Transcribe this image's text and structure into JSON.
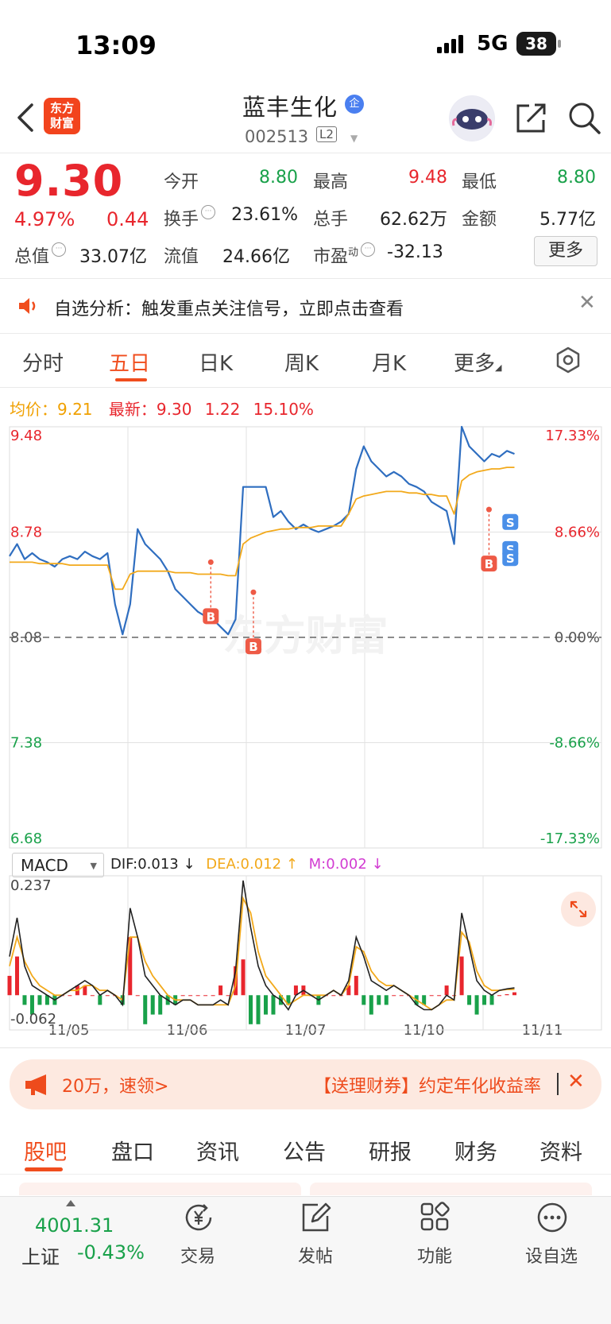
{
  "status_bar": {
    "time": "13:09",
    "network": "5G",
    "battery": "38"
  },
  "header": {
    "logo_text": [
      "东方",
      "财富"
    ],
    "stock_name": "蓝丰生化",
    "verified_badge": "企",
    "stock_code": "002513",
    "level_badge": "L2"
  },
  "quote": {
    "price": "9.30",
    "change_pct": "4.97%",
    "change_amt": "0.44",
    "rows": [
      [
        {
          "label": "今开",
          "value": "8.80",
          "color": "green"
        },
        {
          "label": "最高",
          "value": "9.48",
          "color": "red"
        },
        {
          "label": "最低",
          "value": "8.80",
          "color": "green"
        }
      ],
      [
        {
          "label": "换手",
          "value": "23.61%",
          "color": "black"
        },
        {
          "label": "总手",
          "value": "62.62万",
          "color": "black"
        },
        {
          "label": "金额",
          "value": "5.77亿",
          "color": "black"
        }
      ]
    ],
    "total_value_label": "总值",
    "total_value": "33.07亿",
    "float_label": "流值",
    "float_value": "24.66亿",
    "pe_label": "市盈",
    "pe_sup": "动",
    "pe_value": "-32.13",
    "more_button": "更多"
  },
  "notice": {
    "text": "自选分析：触发重点关注信号，立即点击查看"
  },
  "tabs": [
    "分时",
    "五日",
    "日K",
    "周K",
    "月K",
    "更多"
  ],
  "active_tab": "五日",
  "legend": {
    "avg_label": "均价：",
    "avg_value": "9.21",
    "latest_label": "最新：",
    "latest_value": "9.30",
    "latest_change": "1.22",
    "latest_pct": "15.10%"
  },
  "chart_data": {
    "type": "line",
    "watermark": "东方财富",
    "x_labels": [
      "11/05",
      "11/06",
      "11/07",
      "11/10",
      "11/11"
    ],
    "y_left_ticks": [
      "9.48",
      "8.78",
      "8.08",
      "7.38",
      "6.68"
    ],
    "y_right_ticks": [
      "17.33%",
      "8.66%",
      "0.00%",
      "-8.66%",
      "-17.33%"
    ],
    "ylim": [
      6.68,
      9.48
    ],
    "prev_close": 8.08,
    "series": [
      {
        "name": "price",
        "color": "#2f6ec0",
        "values": [
          8.62,
          8.7,
          8.6,
          8.64,
          8.6,
          8.58,
          8.55,
          8.6,
          8.62,
          8.6,
          8.65,
          8.62,
          8.6,
          8.64,
          8.3,
          8.1,
          8.3,
          8.8,
          8.7,
          8.65,
          8.6,
          8.52,
          8.4,
          8.35,
          8.3,
          8.25,
          8.22,
          8.2,
          8.15,
          8.1,
          8.2,
          9.08,
          9.08,
          9.08,
          9.08,
          8.88,
          8.92,
          8.85,
          8.8,
          8.83,
          8.8,
          8.78,
          8.8,
          8.82,
          8.85,
          8.9,
          9.2,
          9.35,
          9.25,
          9.2,
          9.15,
          9.18,
          9.15,
          9.1,
          9.08,
          9.05,
          8.98,
          8.95,
          8.92,
          8.7,
          9.48,
          9.35,
          9.3,
          9.25,
          9.3,
          9.28,
          9.32,
          9.3
        ]
      },
      {
        "name": "avg",
        "color": "#f2a91b",
        "values": [
          8.58,
          8.58,
          8.58,
          8.58,
          8.57,
          8.57,
          8.57,
          8.57,
          8.56,
          8.56,
          8.56,
          8.56,
          8.56,
          8.56,
          8.4,
          8.4,
          8.5,
          8.52,
          8.52,
          8.52,
          8.52,
          8.52,
          8.51,
          8.51,
          8.51,
          8.5,
          8.5,
          8.5,
          8.5,
          8.49,
          8.49,
          8.7,
          8.74,
          8.76,
          8.78,
          8.79,
          8.8,
          8.8,
          8.81,
          8.81,
          8.81,
          8.82,
          8.82,
          8.82,
          8.82,
          8.9,
          9.0,
          9.02,
          9.03,
          9.04,
          9.05,
          9.05,
          9.05,
          9.04,
          9.04,
          9.03,
          9.03,
          9.02,
          9.02,
          8.9,
          9.12,
          9.16,
          9.18,
          9.19,
          9.2,
          9.2,
          9.21,
          9.21
        ]
      }
    ],
    "buy_sell_markers": [
      {
        "type": "B",
        "x": 0.34,
        "y": 8.58
      },
      {
        "type": "B",
        "x": 0.412,
        "y": 8.38
      },
      {
        "type": "B",
        "x": 0.81,
        "y": 8.93
      },
      {
        "type": "S",
        "x": 0.846,
        "y": 8.9
      },
      {
        "type": "S",
        "x": 0.846,
        "y": 8.72
      },
      {
        "type": "S",
        "x": 0.846,
        "y": 8.66
      }
    ],
    "macd": {
      "selector": "MACD",
      "dif_label": "DIF:0.013 ↓",
      "dea_label": "DEA:0.012 ↑",
      "m_label": "M:0.002 ↓",
      "y_top": "0.237",
      "y_bottom": "-0.062",
      "ylim": [
        -0.062,
        0.237
      ],
      "dif": [
        0.08,
        0.16,
        0.06,
        0.02,
        0.01,
        0.0,
        -0.01,
        0.0,
        0.01,
        0.02,
        0.03,
        0.02,
        0.0,
        0.01,
        0.0,
        -0.02,
        0.18,
        0.12,
        0.04,
        0.02,
        0.0,
        -0.01,
        -0.02,
        -0.01,
        -0.01,
        -0.02,
        -0.02,
        -0.02,
        -0.01,
        -0.02,
        0.05,
        0.237,
        0.14,
        0.06,
        0.02,
        0.0,
        -0.01,
        -0.03,
        0.0,
        0.01,
        0.0,
        -0.01,
        0.0,
        0.01,
        0.0,
        0.03,
        0.12,
        0.08,
        0.03,
        0.02,
        0.01,
        0.02,
        0.01,
        0.0,
        -0.02,
        -0.03,
        -0.03,
        -0.02,
        0.0,
        -0.01,
        0.17,
        0.1,
        0.03,
        0.01,
        0.0,
        0.01,
        0.013,
        0.015
      ],
      "dea": [
        0.06,
        0.12,
        0.07,
        0.04,
        0.02,
        0.01,
        0.0,
        0.0,
        0.01,
        0.01,
        0.02,
        0.02,
        0.01,
        0.01,
        0.0,
        -0.01,
        0.12,
        0.12,
        0.07,
        0.04,
        0.02,
        0.0,
        -0.01,
        -0.01,
        -0.01,
        -0.02,
        -0.02,
        -0.02,
        -0.02,
        -0.02,
        0.02,
        0.2,
        0.17,
        0.09,
        0.04,
        0.02,
        0.0,
        -0.02,
        -0.01,
        0.0,
        0.0,
        0.0,
        0.0,
        0.01,
        0.0,
        0.02,
        0.1,
        0.09,
        0.05,
        0.03,
        0.02,
        0.02,
        0.01,
        0.0,
        -0.01,
        -0.02,
        -0.03,
        -0.02,
        -0.01,
        -0.01,
        0.13,
        0.11,
        0.05,
        0.02,
        0.01,
        0.01,
        0.012,
        0.012
      ]
    }
  },
  "ad": {
    "text1": "20万，速领>",
    "text2": "【送理财券】约定年化收益率"
  },
  "bottom_tabs": [
    "股吧",
    "盘口",
    "资讯",
    "公告",
    "研报",
    "财务",
    "资料"
  ],
  "index": {
    "value": "4001.31",
    "name": "上证",
    "pct": "-0.43%"
  },
  "nav": [
    {
      "label": "交易",
      "icon": "yen-exchange-icon"
    },
    {
      "label": "发帖",
      "icon": "compose-icon"
    },
    {
      "label": "功能",
      "icon": "grid-icon"
    },
    {
      "label": "设自选",
      "icon": "more-dots-icon"
    }
  ]
}
